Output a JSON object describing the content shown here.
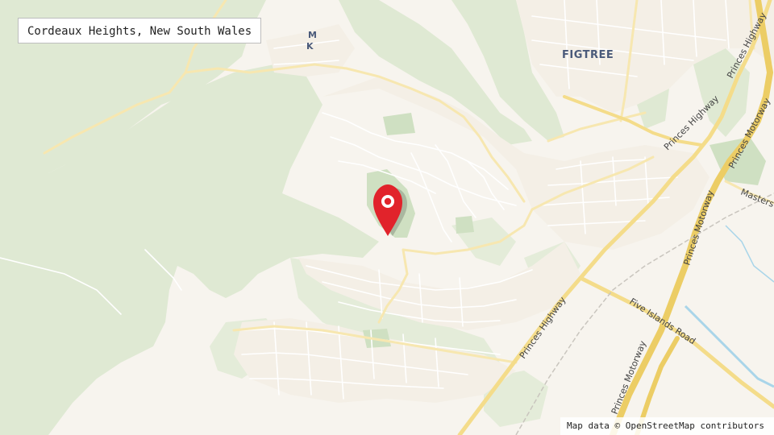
{
  "map": {
    "title": "Cordeaux Heights, New South Wales",
    "attribution": "Map data ©  OpenStreetMap contributors",
    "marker_icon": "map-pin-icon",
    "colors": {
      "land": "#f7f4ee",
      "bush": "#dfe9d3",
      "park": "#cfe0c2",
      "urban": "#f4efe6",
      "road": "#ffffff",
      "major_road": "#f4dc8a",
      "motorway": "#eccd65",
      "water": "#a9d5e9",
      "marker": "#e1232b"
    },
    "labels": {
      "suburb": "FIGTREE",
      "partial_suburb_1": "M",
      "partial_suburb_2": "K",
      "princes_highway": "Princes Highway",
      "princes_motorway": "Princes Motorway",
      "five_islands_road": "Five Islands Road",
      "masters": "Masters"
    }
  }
}
